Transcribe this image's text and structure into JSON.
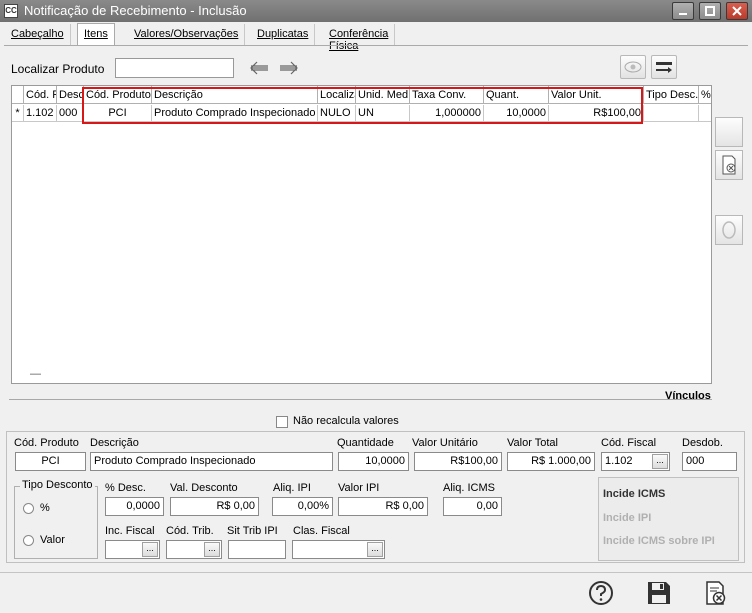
{
  "window": {
    "app_icon": "CC",
    "title": "Notificação de Recebimento - Inclusão"
  },
  "tabs": [
    {
      "label": "Cabeçalho"
    },
    {
      "label": "Itens",
      "active": true
    },
    {
      "label": "Valores/Observações"
    },
    {
      "label": "Duplicatas"
    },
    {
      "label": "Conferência Física"
    }
  ],
  "search": {
    "label": "Localizar Produto",
    "value": ""
  },
  "grid": {
    "columns": [
      "",
      "Cód. F",
      "Desc",
      "Cód. Produto",
      "Descrição",
      "Localiza",
      "Unid. Med.",
      "Taxa Conv.",
      "Quant.",
      "Valor Unit.",
      "Tipo Desc.",
      "%"
    ],
    "row": {
      "marker": "*",
      "cod_fiscal": "1.102",
      "desdob": "000",
      "cod_produto": "PCI",
      "descricao": "Produto Comprado Inspecionado",
      "localizacao": "NULO",
      "unid_med": "UN",
      "taxa_conv": "1,000000",
      "quant": "10,0000",
      "valor_unit": "R$100,00",
      "tipo_desc": "",
      "perc": ""
    },
    "footer_mark": "—"
  },
  "vinculos_label": "Vínculos",
  "nao_recalcula_label": "Não recalcula valores",
  "details": {
    "cod_produto_label": "Cód. Produto",
    "cod_produto": "PCI",
    "descricao_label": "Descrição",
    "descricao": "Produto Comprado Inspecionado",
    "quantidade_label": "Quantidade",
    "quantidade": "10,0000",
    "valor_unitario_label": "Valor Unitário",
    "valor_unitario": "R$100,00",
    "valor_total_label": "Valor Total",
    "valor_total": "R$ 1.000,00",
    "cod_fiscal_label": "Cód. Fiscal",
    "cod_fiscal": "1.102",
    "desdob_label": "Desdob.",
    "desdob": "000",
    "tipo_desconto_label": "Tipo Desconto",
    "radio_percent": "%",
    "radio_valor": "Valor",
    "perc_desc_label": "% Desc.",
    "perc_desc": "0,0000",
    "val_desconto_label": "Val. Desconto",
    "val_desconto": "R$ 0,00",
    "aliq_ipi_label": "Aliq. IPI",
    "aliq_ipi": "0,00%",
    "valor_ipi_label": "Valor IPI",
    "valor_ipi": "R$ 0,00",
    "aliq_icms_label": "Aliq. ICMS",
    "aliq_icms": "0,00",
    "inc_fiscal_label": "Inc. Fiscal",
    "cod_trib_label": "Cód. Trib.",
    "sit_trib_ipi_label": "Sit Trib IPI",
    "clas_fiscal_label": "Clas. Fiscal",
    "ellipsis": "..."
  },
  "incide": {
    "icms": "Incide ICMS",
    "ipi": "Incide IPI",
    "icms_sobre_ipi": "Incide ICMS sobre IPI"
  },
  "icons": [
    "app-icon",
    "minimize-icon",
    "maximize-icon",
    "close-icon",
    "arrow-left-icon",
    "arrow-right-icon",
    "eye-icon",
    "column-config-icon",
    "delete-item-icon",
    "circle-icon",
    "help-icon",
    "save-icon",
    "cancel-document-icon"
  ]
}
